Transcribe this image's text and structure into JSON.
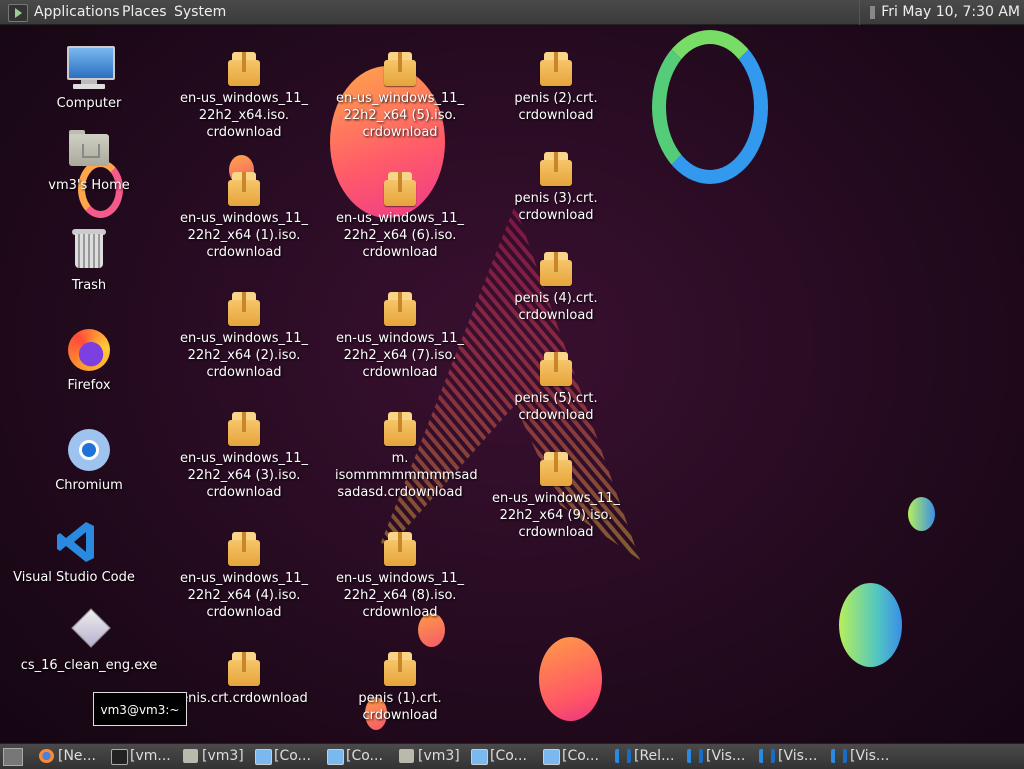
{
  "top_panel": {
    "menus": [
      "Applications",
      "Places",
      "System"
    ],
    "clock": "Fri May 10,  7:30 AM"
  },
  "desktop_left": [
    {
      "label": "Computer",
      "icon": "computer-icon"
    },
    {
      "label": "vm3's Home",
      "icon": "home-folder-icon"
    },
    {
      "label": "Trash",
      "icon": "trash-icon"
    },
    {
      "label": "Firefox",
      "icon": "firefox-icon"
    },
    {
      "label": "Chromium",
      "icon": "chromium-icon"
    },
    {
      "label": "Visual Studio Code",
      "icon": "vscode-icon"
    },
    {
      "label": "cs_16_clean_eng.exe",
      "icon": "exe-icon"
    }
  ],
  "desktop_files": [
    {
      "label": "en-us_windows_11_\n22h2_x64.iso.\ncrdownload"
    },
    {
      "label": "en-us_windows_11_\n22h2_x64 (1).iso.\ncrdownload"
    },
    {
      "label": "en-us_windows_11_\n22h2_x64 (2).iso.\ncrdownload"
    },
    {
      "label": "en-us_windows_11_\n22h2_x64 (3).iso.\ncrdownload"
    },
    {
      "label": "en-us_windows_11_\n22h2_x64 (4).iso.\ncrdownload"
    },
    {
      "label": "enis.crt.crdownload"
    },
    {
      "label": "en-us_windows_11_\n22h2_x64 (5).iso.\ncrdownload"
    },
    {
      "label": "en-us_windows_11_\n22h2_x64 (6).iso.\ncrdownload"
    },
    {
      "label": "en-us_windows_11_\n22h2_x64 (7).iso.\ncrdownload"
    },
    {
      "label": "m.\nisommmmmmmmsad\nsadasd.crdownload"
    },
    {
      "label": "en-us_windows_11_\n22h2_x64 (8).iso.\ncrdownload"
    },
    {
      "label": "penis (1).crt.\ncrdownload"
    },
    {
      "label": "penis (2).crt.\ncrdownload"
    },
    {
      "label": "penis (3).crt.\ncrdownload"
    },
    {
      "label": "penis (4).crt.\ncrdownload"
    },
    {
      "label": "penis (5).crt.\ncrdownload"
    },
    {
      "label": "en-us_windows_11_\n22h2_x64 (9).iso.\ncrdownload"
    }
  ],
  "tooltip": "vm3@vm3:~",
  "taskbar": {
    "items": [
      {
        "label": "[Ne...",
        "icon": "firefox-icon"
      },
      {
        "label": "[vm...",
        "icon": "terminal-icon"
      },
      {
        "label": "[vm3]",
        "icon": "folder-icon"
      },
      {
        "label": "[Co...",
        "icon": "monitor-icon"
      },
      {
        "label": "[Co...",
        "icon": "monitor-icon"
      },
      {
        "label": "[vm3]",
        "icon": "folder-icon"
      },
      {
        "label": "[Co...",
        "icon": "monitor-icon"
      },
      {
        "label": "[Co...",
        "icon": "monitor-icon"
      },
      {
        "label": "[Rel...",
        "icon": "vscode-icon"
      },
      {
        "label": "[Vis...",
        "icon": "vscode-icon"
      },
      {
        "label": "[Vis...",
        "icon": "vscode-icon"
      },
      {
        "label": "[Vis...",
        "icon": "vscode-icon"
      }
    ]
  }
}
